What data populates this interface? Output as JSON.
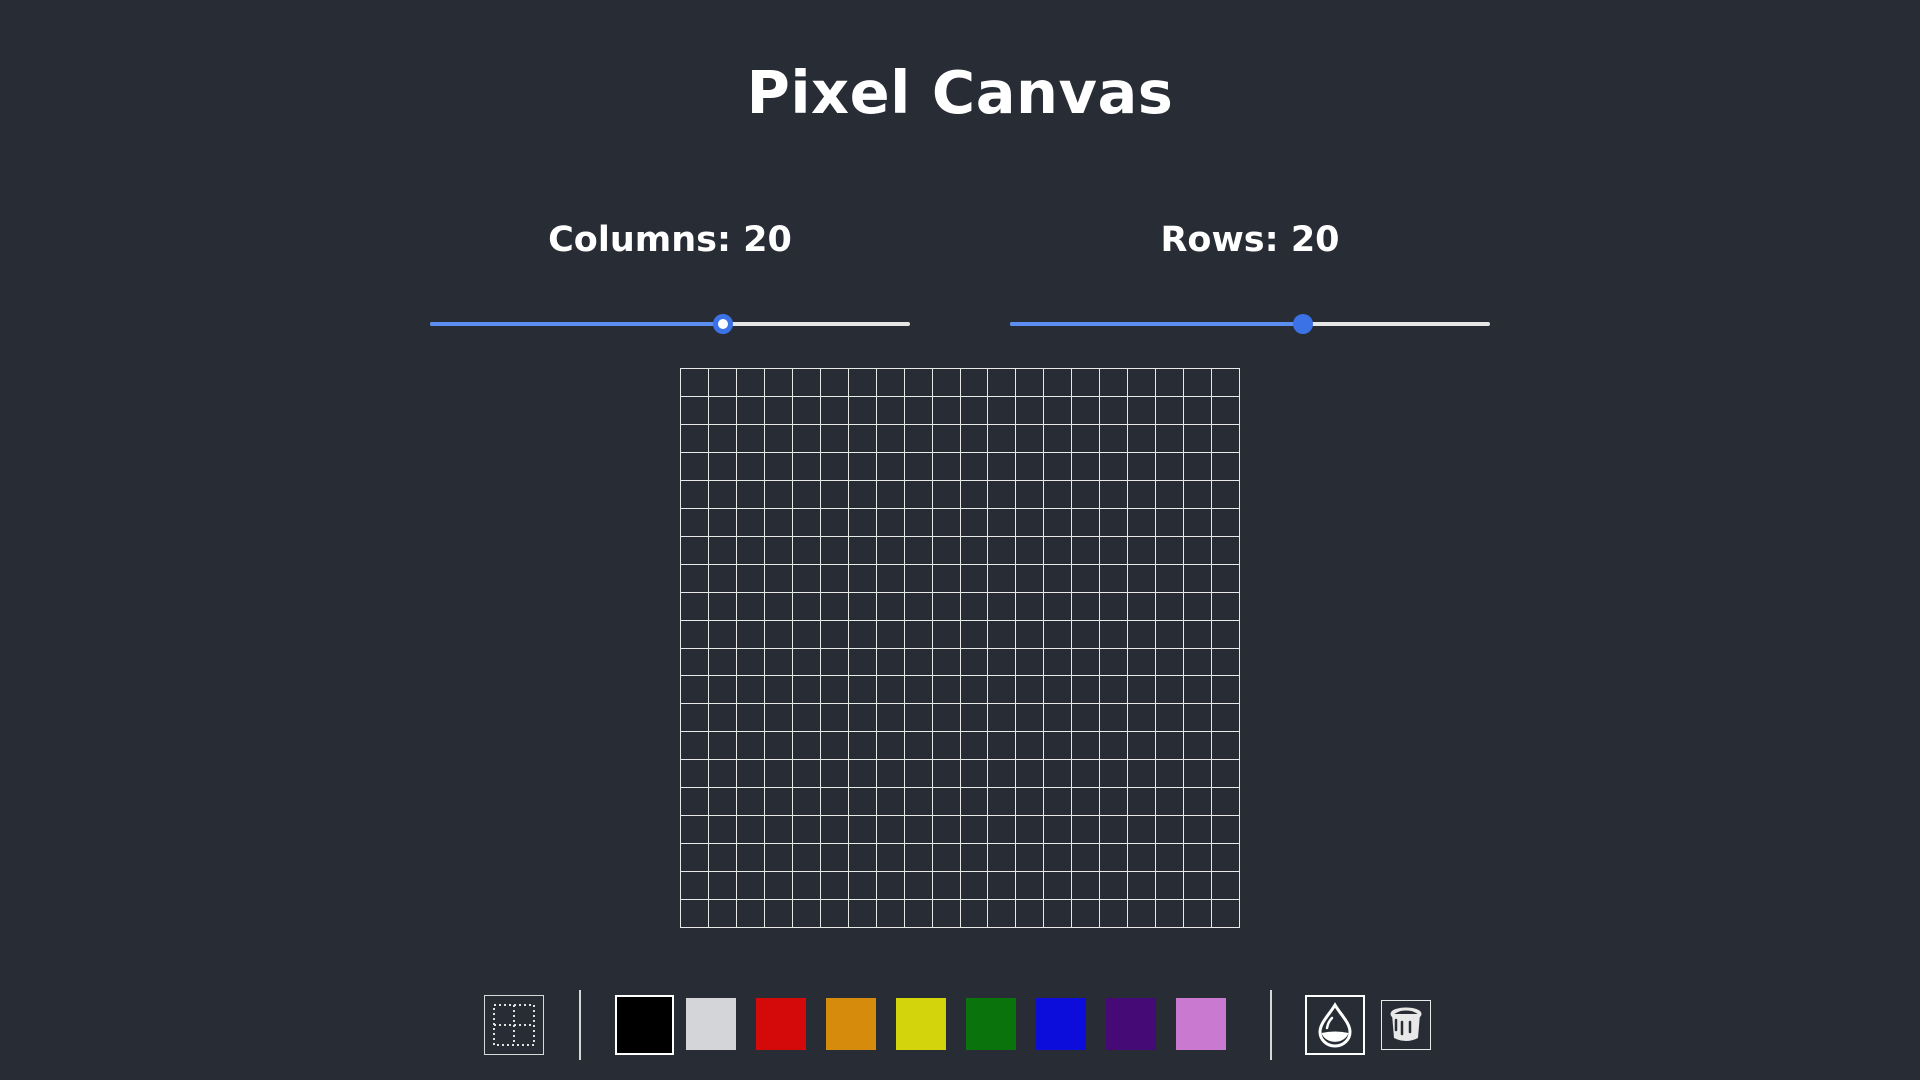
{
  "app": {
    "title": "Pixel Canvas"
  },
  "controls": {
    "columns": {
      "label": "Columns: 20",
      "value": 20,
      "fraction": 0.61
    },
    "rows": {
      "label": "Rows: 20",
      "value": 20,
      "fraction": 0.61
    }
  },
  "canvas": {
    "columns": 20,
    "rows": 20,
    "grid_color": "#e8e8e8",
    "background": "#282c35"
  },
  "toolbar": {
    "grid_toggle_icon": "dotted-grid-icon",
    "palette": [
      {
        "name": "black",
        "hex": "#000000",
        "selected": true
      },
      {
        "name": "light-gray",
        "hex": "#d4d5d9",
        "selected": false
      },
      {
        "name": "red",
        "hex": "#d40a0a",
        "selected": false
      },
      {
        "name": "orange",
        "hex": "#d68b0c",
        "selected": false
      },
      {
        "name": "yellow",
        "hex": "#d4d40c",
        "selected": false
      },
      {
        "name": "green",
        "hex": "#0a730c",
        "selected": false
      },
      {
        "name": "blue",
        "hex": "#0c0cdb",
        "selected": false
      },
      {
        "name": "purple",
        "hex": "#450a75",
        "selected": false
      },
      {
        "name": "pink",
        "hex": "#c979cf",
        "selected": false
      }
    ],
    "tools": [
      {
        "name": "drop-fill",
        "icon": "water-drop-icon",
        "active": true
      },
      {
        "name": "bucket-fill",
        "icon": "paint-bucket-icon",
        "active": false
      }
    ]
  },
  "colors": {
    "background": "#282c35",
    "accent": "#3b73e6",
    "text": "#ffffff"
  }
}
